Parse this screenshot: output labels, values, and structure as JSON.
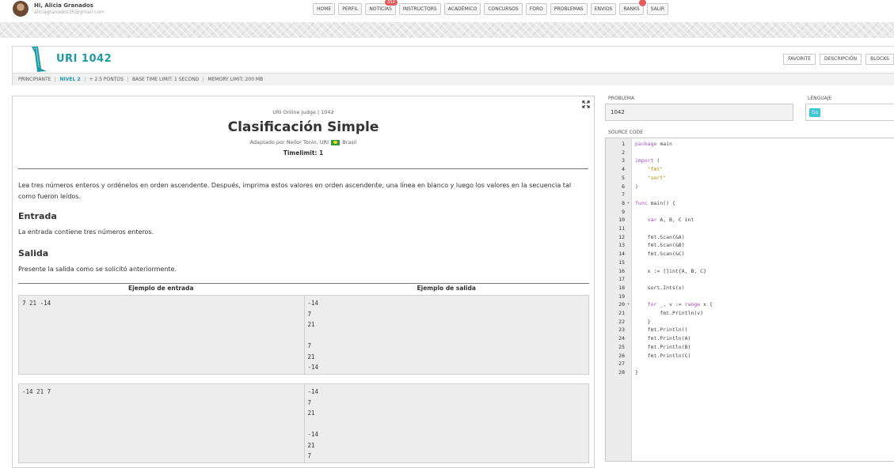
{
  "user": {
    "greeting": "Hi, Alicia Granados",
    "email": "aliciagranados35@gmail.com"
  },
  "nav": {
    "items": [
      "HOME",
      "PERFIL",
      "NOTICIAS",
      "INSTRUCTORS",
      "ACADÉMICO",
      "CONCURSOS",
      "FORO",
      "PROBLEMAS",
      "ENVIOS",
      "RANKS",
      "SALIR"
    ],
    "news_badge": "352"
  },
  "problem": {
    "id": "URI 1042",
    "buttons": [
      "FAVORITE",
      "DESCRIPCIÓN",
      "BLOCKS"
    ],
    "meta": [
      "PRINCIPIANTE",
      "NIVEL 2",
      "+ 2.5 PONTOS",
      "BASE TIME LIMIT: 1 SECOND",
      "MEMORY LIMIT: 200 MB"
    ]
  },
  "statement": {
    "judge": "URI Online Judge | 1042",
    "title": "Clasificación Simple",
    "adapted_prefix": "Adaptado por Neilor Tonin, URI",
    "adapted_suffix": "Brasil",
    "timelimit": "Timelimit: 1",
    "description": "Lea tres números enteros y ordénelos en orden ascendente. Después, imprima estos valores en orden ascendente, una línea en blanco y luego los valores en la secuencia tal como fueron leídos.",
    "input_title": "Entrada",
    "input_text": "La entrada contiene tres números enteros.",
    "output_title": "Salida",
    "output_text": "Presente la salida como se solicitó anteriormente.",
    "example_input_header": "Ejemplo de entrada",
    "example_output_header": "Ejemplo de salida",
    "examples": [
      {
        "input": "7 21 -14",
        "output": "-14\n7\n21\n\n7\n21\n-14"
      },
      {
        "input": "-14 21 7",
        "output": "-14\n7\n21\n\n-14\n21\n7"
      }
    ]
  },
  "editor": {
    "problem_label": "PROBLEMA",
    "problem_value": "1042",
    "language_label": "LENGUAJE",
    "language_value": "Go",
    "source_label": "SOURCE CODE",
    "lines": [
      "package main",
      "",
      "import (",
      "    \"fmt\"",
      "    \"sort\"",
      ")",
      "",
      "func main() {",
      "",
      "    var A, B, C int",
      "",
      "    fmt.Scan(&A)",
      "    fmt.Scan(&B)",
      "    fmt.Scan(&C)",
      "",
      "    x := []int{A, B, C}",
      "",
      "    sort.Ints(x)",
      "",
      "    for _, v := range x {",
      "        fmt.Println(v)",
      "    }",
      "    fmt.Println()",
      "    fmt.Println(A)",
      "    fmt.Println(B)",
      "    fmt.Println(C)",
      "",
      "}"
    ],
    "fold_lines": [
      8,
      20
    ]
  },
  "colors": {
    "accent": "#1e9aa5",
    "badge": "#e55b5b",
    "go_chip": "#3ec6d7"
  }
}
